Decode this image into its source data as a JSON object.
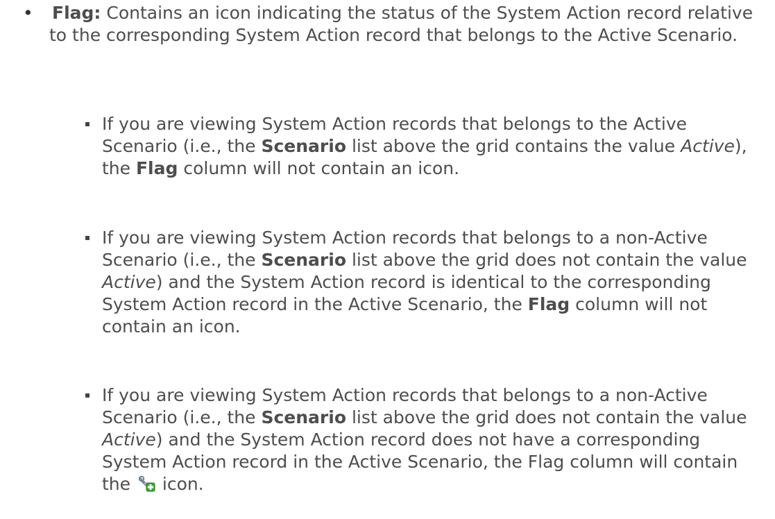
{
  "main_item": {
    "label": "Flag:",
    "text": "Contains an icon indicating the status of the System Action record relative to the corresponding System Action record that belongs to the Active Scenario."
  },
  "sub_items": [
    {
      "t1": "If you are viewing System Action records that belongs to the Active Scenario (i.e., the ",
      "b1": "Scenario",
      "t2": " list above the grid contains the value ",
      "i1": "Active",
      "t3": "), the ",
      "b2": "Flag",
      "t4": " column will not contain an icon."
    },
    {
      "t1": "If you are viewing System Action records that belongs to a non-Active Scenario (i.e., the ",
      "b1": "Scenario",
      "t2": " list above the grid does not contain the value ",
      "i1": "Active",
      "t3": ") and the System Action record is identical to the corresponding System Action record in the Active Scenario, the ",
      "b2": "Flag",
      "t4": " column will not contain an icon."
    },
    {
      "t1": "If you are viewing System Action records that belongs to a non-Active Scenario (i.e., the ",
      "b1": "Scenario",
      "t2": " list above the grid does not contain the value ",
      "i1": "Active",
      "t3": ") and the System Action record does not have a corresponding System Action record in the Active Scenario, the Flag column will contain the ",
      "t4": " icon."
    }
  ],
  "icons": {
    "add_action_icon": "wrench-with-green-plus-icon"
  }
}
